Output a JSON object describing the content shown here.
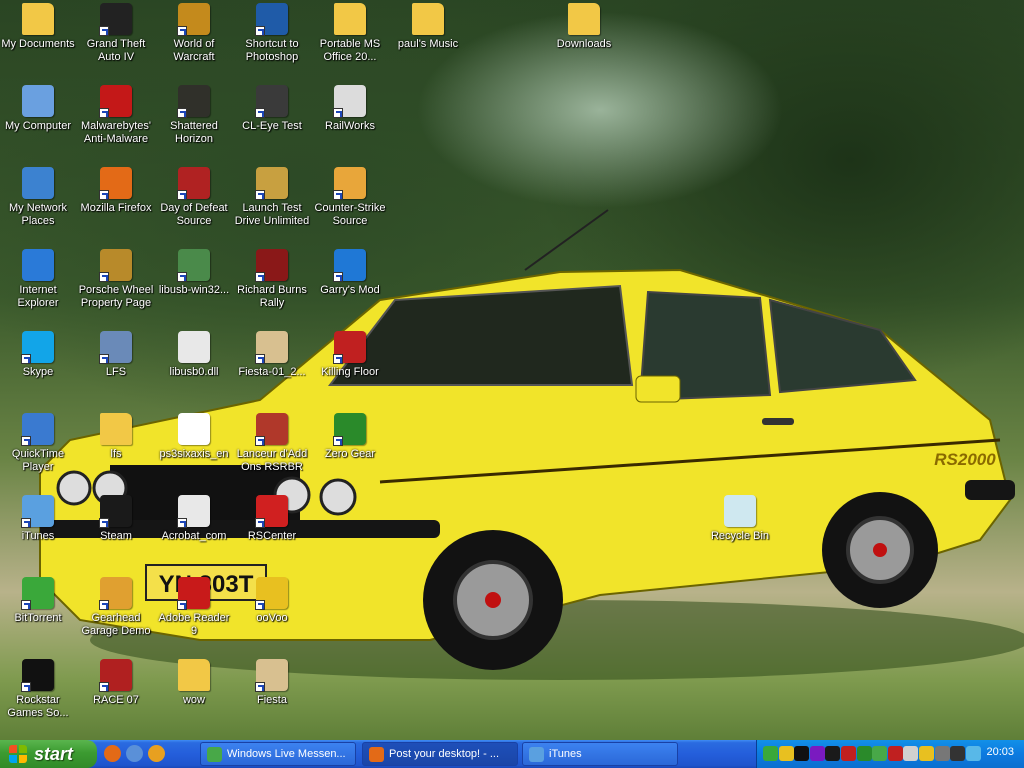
{
  "desktop": {
    "icons": [
      {
        "label": "My Documents",
        "icon": "my-documents-icon",
        "color": "#f2c846"
      },
      {
        "label": "Grand Theft Auto IV",
        "icon": "gta-iv-icon",
        "color": "#222222"
      },
      {
        "label": "World of Warcraft",
        "icon": "warcraft-icon",
        "color": "#c48a1c"
      },
      {
        "label": "Shortcut to Photoshop",
        "icon": "photoshop-icon",
        "color": "#1f5ba8"
      },
      {
        "label": "Portable MS Office 20...",
        "icon": "folder-icon",
        "color": "#f2c846"
      },
      {
        "label": "paul's Music",
        "icon": "music-folder-icon",
        "color": "#f2c846"
      },
      {
        "label": "Downloads",
        "icon": "folder-icon",
        "color": "#f2c846"
      },
      {
        "label": "My Computer",
        "icon": "my-computer-icon",
        "color": "#6aa0e0"
      },
      {
        "label": "Malwarebytes' Anti-Malware",
        "icon": "malwarebytes-icon",
        "color": "#c41818"
      },
      {
        "label": "Shattered Horizon",
        "icon": "shattered-horizon-icon",
        "color": "#30302a"
      },
      {
        "label": "CL-Eye Test",
        "icon": "camera-icon",
        "color": "#3a3a3a"
      },
      {
        "label": "RailWorks",
        "icon": "railworks-icon",
        "color": "#dcdcdc"
      },
      {
        "label": "My Network Places",
        "icon": "network-places-icon",
        "color": "#3c82d0"
      },
      {
        "label": "Mozilla Firefox",
        "icon": "firefox-icon",
        "color": "#e36a17"
      },
      {
        "label": "Day of Defeat Source",
        "icon": "dod-icon",
        "color": "#b02222"
      },
      {
        "label": "Launch Test Drive Unlimited",
        "icon": "tdu-icon",
        "color": "#c8a040"
      },
      {
        "label": "Counter-Strike Source",
        "icon": "counter-strike-icon",
        "color": "#e8a63a"
      },
      {
        "label": "Internet Explorer",
        "icon": "internet-explorer-icon",
        "color": "#2a7ad8"
      },
      {
        "label": "Porsche Wheel Property Page",
        "icon": "porsche-icon",
        "color": "#b88a2a"
      },
      {
        "label": "libusb-win32...",
        "icon": "libusb-icon",
        "color": "#4a8a4a"
      },
      {
        "label": "Richard Burns Rally",
        "icon": "rbr-icon",
        "color": "#8a1818"
      },
      {
        "label": "Garry's Mod",
        "icon": "garrys-mod-icon",
        "color": "#1f78d6"
      },
      {
        "label": "Skype",
        "icon": "skype-icon",
        "color": "#12a5e8"
      },
      {
        "label": "LFS",
        "icon": "lfs-icon",
        "color": "#6a8ab8"
      },
      {
        "label": "libusb0.dll",
        "icon": "dll-file-icon",
        "color": "#e8e8e8"
      },
      {
        "label": "Fiesta-01_2...",
        "icon": "fiesta-image-icon",
        "color": "#d8c090"
      },
      {
        "label": "Killing Floor",
        "icon": "killing-floor-icon",
        "color": "#c02020"
      },
      {
        "label": "QuickTime Player",
        "icon": "quicktime-icon",
        "color": "#3a7ad0"
      },
      {
        "label": "lfs",
        "icon": "folder-icon",
        "color": "#f2c846"
      },
      {
        "label": "ps3sixaxis_en",
        "icon": "exe-window-icon",
        "color": "#ffffff"
      },
      {
        "label": "Lanceur d'Add Ons RSRBR",
        "icon": "rsrbr-icon",
        "color": "#b0382a"
      },
      {
        "label": "Zero Gear",
        "icon": "zero-gear-icon",
        "color": "#2a8a2a"
      },
      {
        "label": "iTunes",
        "icon": "itunes-icon",
        "color": "#5aa0e0"
      },
      {
        "label": "Steam",
        "icon": "steam-icon",
        "color": "#1a1a1a"
      },
      {
        "label": "Acrobat_com",
        "icon": "acrobat-icon",
        "color": "#e8e8e8"
      },
      {
        "label": "RSCenter",
        "icon": "rscenter-icon",
        "color": "#d02020"
      },
      {
        "label": "Recycle Bin",
        "icon": "recycle-bin-icon",
        "color": "#cfe8f0"
      },
      {
        "label": "BitTorrent",
        "icon": "bittorrent-icon",
        "color": "#3aa83a"
      },
      {
        "label": "Gearhead Garage Demo",
        "icon": "gearhead-icon",
        "color": "#e0a030"
      },
      {
        "label": "Adobe Reader 9",
        "icon": "adobe-reader-icon",
        "color": "#c81a1a"
      },
      {
        "label": "ooVoo",
        "icon": "oovoo-icon",
        "color": "#e8c020"
      },
      {
        "label": "Rockstar Games So...",
        "icon": "rockstar-icon",
        "color": "#111111"
      },
      {
        "label": "RACE 07",
        "icon": "race07-icon",
        "color": "#b02020"
      },
      {
        "label": "wow",
        "icon": "folder-icon",
        "color": "#f2c846"
      },
      {
        "label": "Fiesta",
        "icon": "fiesta-image-icon",
        "color": "#d8c090"
      }
    ],
    "wallpaper": {
      "plate": "YN 303T",
      "badge": "RS2000"
    }
  },
  "taskbar": {
    "start_label": "start",
    "quick_launch": [
      {
        "icon": "firefox-icon",
        "color": "#e36a17"
      },
      {
        "icon": "show-desktop-icon",
        "color": "#5a90d8"
      },
      {
        "icon": "media-player-icon",
        "color": "#e8a020"
      }
    ],
    "tasks": [
      {
        "label": "Windows Live Messen...",
        "icon": "messenger-icon",
        "color": "#48a848",
        "active": false
      },
      {
        "label": "Post your desktop! - ...",
        "icon": "firefox-icon",
        "color": "#e36a17",
        "active": true
      },
      {
        "label": "iTunes",
        "icon": "itunes-icon",
        "color": "#5aa0e0",
        "active": false
      }
    ],
    "tray_icons": [
      {
        "icon": "bittorrent-tray-icon",
        "color": "#3aa83a"
      },
      {
        "icon": "security-shield-icon",
        "color": "#e8c020"
      },
      {
        "icon": "rockstar-tray-icon",
        "color": "#111111"
      },
      {
        "icon": "media-tray-icon",
        "color": "#7a1ac0"
      },
      {
        "icon": "steam-tray-icon",
        "color": "#1a1a1a"
      },
      {
        "icon": "tool-tray-icon",
        "color": "#c02020"
      },
      {
        "icon": "network-tray-icon",
        "color": "#2a8a2a"
      },
      {
        "icon": "messenger-tray-icon",
        "color": "#48a848"
      },
      {
        "icon": "shield-tray-icon",
        "color": "#c02020"
      },
      {
        "icon": "volume-tray-icon",
        "color": "#d0d0d0"
      },
      {
        "icon": "oovoo-tray-icon",
        "color": "#e8c020"
      },
      {
        "icon": "gray-tray-icon",
        "color": "#777777"
      },
      {
        "icon": "monitor-tray-icon",
        "color": "#333333"
      },
      {
        "icon": "sync-tray-icon",
        "color": "#58b8e8"
      }
    ],
    "clock": "20:03"
  }
}
